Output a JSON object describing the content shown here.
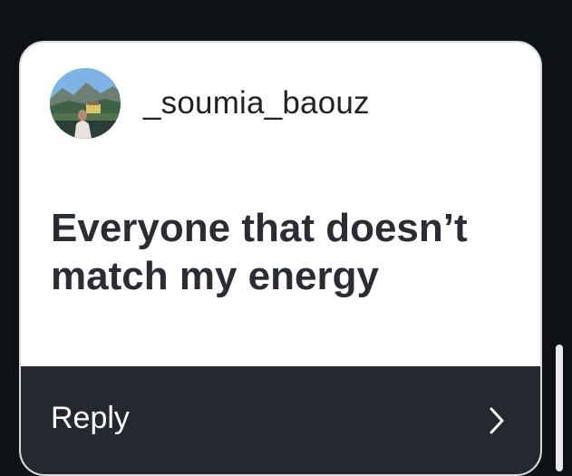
{
  "story_reply": {
    "username": "_soumia_baouz",
    "question_line1": "Everyone that doesn’t",
    "question_line2": "match my energy",
    "reply_label": "Reply"
  },
  "icons": {
    "avatar": "profile-photo",
    "chevron": "chevron-right-icon"
  },
  "colors": {
    "background": "#0e1116",
    "card": "#ffffff",
    "reply_bar": "#25292f",
    "text_dark": "#2a2d33"
  }
}
